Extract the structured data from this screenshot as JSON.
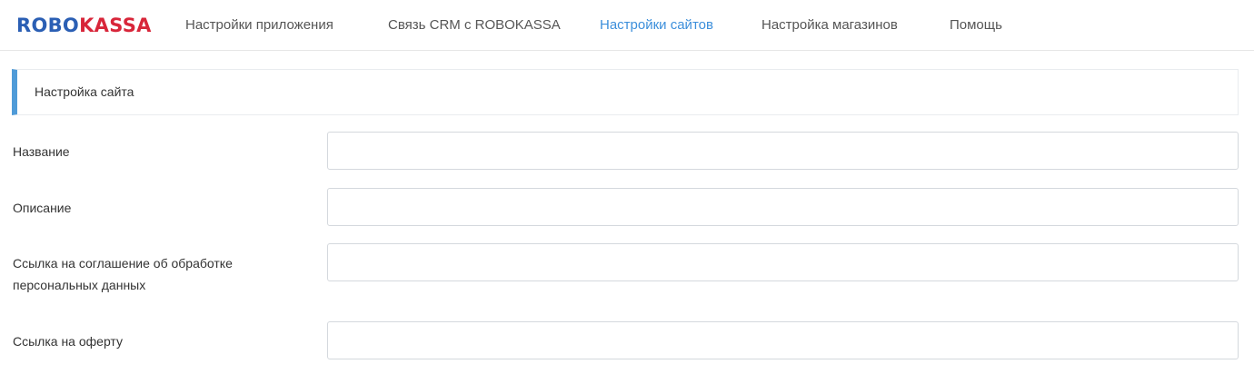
{
  "brand": {
    "part1": "ROBO",
    "part2": "KASSA",
    "color1": "#2b5fb4",
    "color2": "#d8263a"
  },
  "nav": {
    "items": [
      {
        "label": "Настройки приложения",
        "active": false
      },
      {
        "label": "Связь CRM с ROBOKASSA",
        "active": false
      },
      {
        "label": "Настройки сайтов",
        "active": true
      },
      {
        "label": "Настройка магазинов",
        "active": false
      },
      {
        "label": "Помощь",
        "active": false
      }
    ],
    "active_color": "#3c8fdb"
  },
  "section": {
    "title": "Настройка сайта",
    "accent": "#4f9bd8"
  },
  "form": {
    "fields": [
      {
        "label": "Название",
        "value": ""
      },
      {
        "label": "Описание",
        "value": ""
      },
      {
        "label": "Ссылка на соглашение об обработке персональных данных",
        "value": ""
      },
      {
        "label": "Ссылка на оферту",
        "value": ""
      }
    ]
  }
}
